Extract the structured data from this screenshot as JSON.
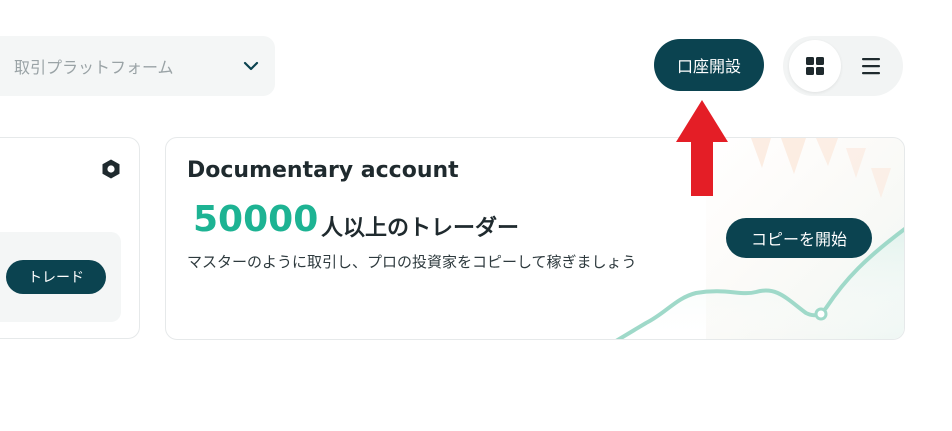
{
  "header": {
    "platform_placeholder": "取引プラットフォーム",
    "open_account_label": "口座開設"
  },
  "left_card": {
    "trade_label": "トレード"
  },
  "doc_card": {
    "title": "Documentary account",
    "count": "50000",
    "count_suffix": "人以上のトレーダー",
    "description": "マスターのように取引し、プロの投資家をコピーして稼ぎましょう",
    "copy_label": "コピーを開始"
  },
  "colors": {
    "primary": "#0b4350",
    "accent_green": "#1db393",
    "arrow_red": "#e41e26"
  }
}
